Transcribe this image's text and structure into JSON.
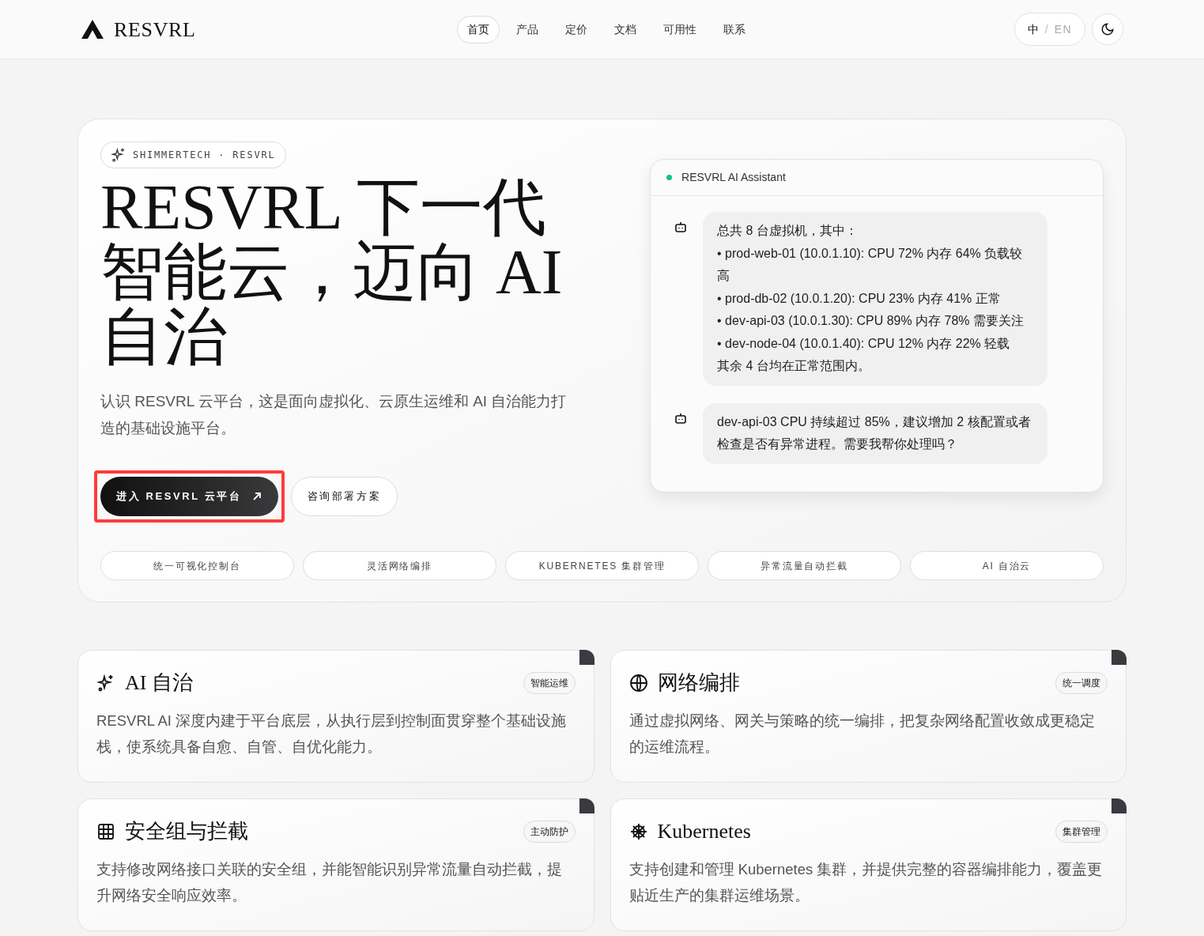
{
  "header": {
    "brand": "RESVRL",
    "nav": [
      {
        "label": "首页",
        "selected": true
      },
      {
        "label": "产品",
        "selected": false
      },
      {
        "label": "定价",
        "selected": false
      },
      {
        "label": "文档",
        "selected": false
      },
      {
        "label": "可用性",
        "selected": false
      },
      {
        "label": "联系",
        "selected": false
      }
    ],
    "language": {
      "options": [
        {
          "label": "中",
          "selected": true
        },
        {
          "label": "EN",
          "selected": false
        }
      ],
      "separator": "/"
    }
  },
  "hero": {
    "eyebrow": "SHIMMERTECH · RESVRL",
    "title": "RESVRL 下一代智能云，迈向 AI 自治",
    "subtitle": "认识 RESVRL 云平台，这是面向虚拟化、云原生运维和 AI 自治能力打造的基础设施平台。",
    "primary_button": {
      "label": "进入 RESVRL 云平台",
      "highlighted": true
    },
    "secondary_button": {
      "label": "咨询部署方案"
    },
    "chips": [
      "统一可视化控制台",
      "灵活网络编排",
      "KUBERNETES 集群管理",
      "异常流量自动拦截",
      "AI 自治云"
    ],
    "assistant": {
      "title": "RESVRL AI Assistant",
      "online": true,
      "messages": [
        {
          "lines": [
            "总共 8 台虚拟机，其中：",
            "• prod-web-01 (10.0.1.10): CPU 72% 内存 64% 负载较高",
            "• prod-db-02 (10.0.1.20): CPU 23% 内存 41% 正常",
            "• dev-api-03 (10.0.1.30): CPU 89% 内存 78% 需要关注",
            "• dev-node-04 (10.0.1.40): CPU 12% 内存 22% 轻载",
            "其余 4 台均在正常范围内。"
          ]
        },
        {
          "lines": [
            "dev-api-03 CPU 持续超过 85%，建议增加 2 核配置或者检查是否有异常进程。需要我帮你处理吗？"
          ]
        }
      ]
    }
  },
  "features": [
    {
      "title": "AI 自治",
      "tag": "智能运维",
      "description": "RESVRL AI 深度内建于平台底层，从执行层到控制面贯穿整个基础设施栈，使系统具备自愈、自管、自优化能力。"
    },
    {
      "title": "网络编排",
      "tag": "统一调度",
      "description": "通过虚拟网络、网关与策略的统一编排，把复杂网络配置收敛成更稳定的运维流程。"
    },
    {
      "title": "安全组与拦截",
      "tag": "主动防护",
      "description": "支持修改网络接口关联的安全组，并能智能识别异常流量自动拦截，提升网络安全响应效率。"
    },
    {
      "title": "Kubernetes",
      "tag": "集群管理",
      "description": "支持创建和管理 Kubernetes 集群，并提供完整的容器编排能力，覆盖更贴近生产的集群运维场景。"
    }
  ]
}
